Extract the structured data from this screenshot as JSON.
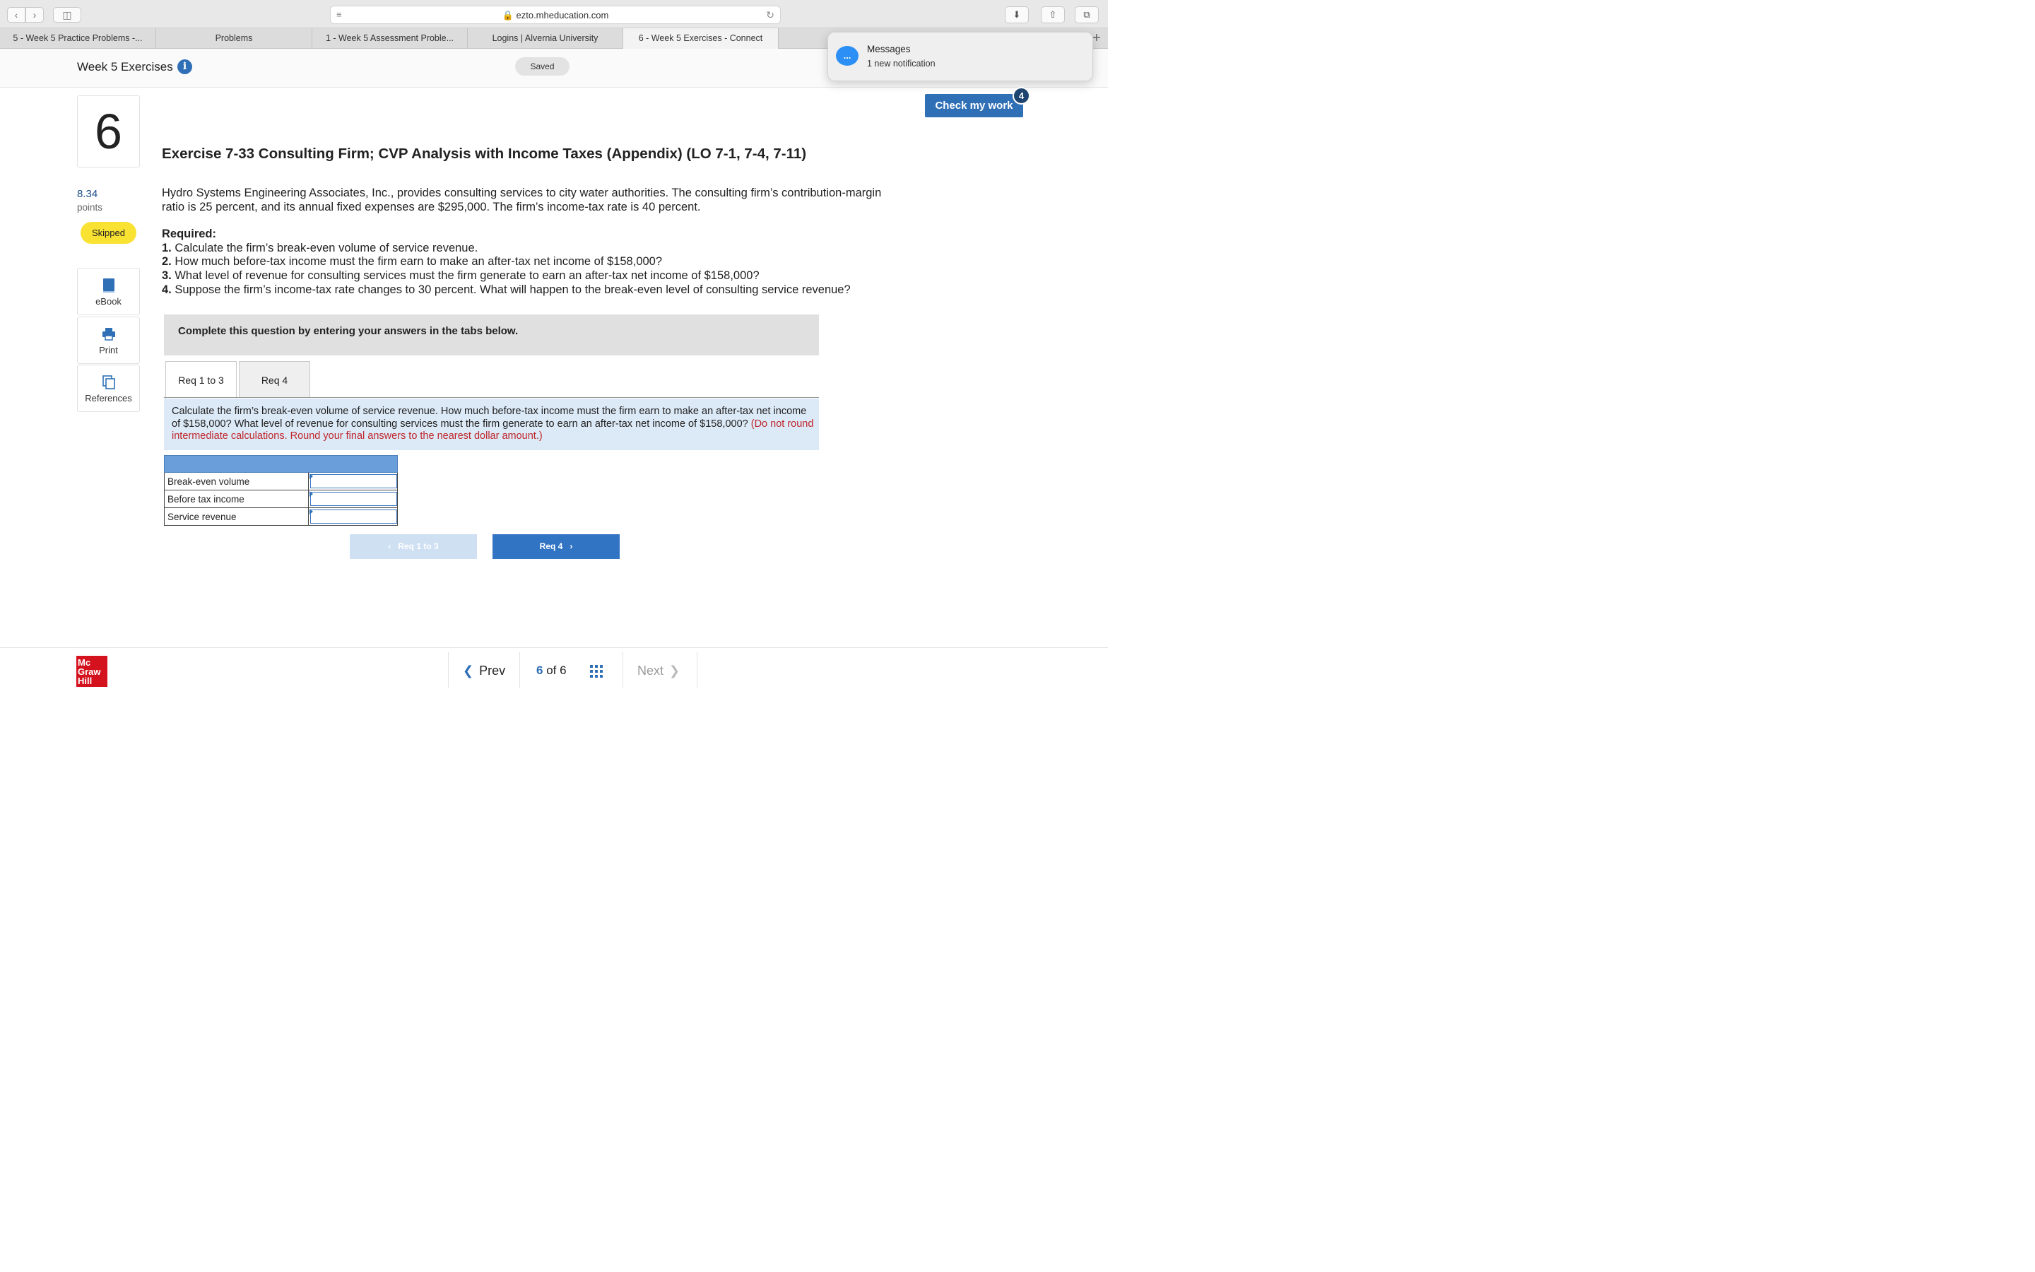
{
  "browser": {
    "url": "ezto.mheducation.com",
    "tabs": [
      {
        "label": "5 - Week 5 Practice Problems -...",
        "active": false
      },
      {
        "label": "Problems",
        "active": false
      },
      {
        "label": "1 - Week 5 Assessment Proble...",
        "active": false
      },
      {
        "label": "Logins | Alvernia University",
        "active": false
      },
      {
        "label": "6 - Week 5 Exercises - Connect",
        "active": true
      }
    ],
    "new_tab": "+"
  },
  "header": {
    "assignment_title": "Week 5 Exercises",
    "info_icon": "i",
    "saved": "Saved"
  },
  "notification": {
    "title": "Messages",
    "body": "1 new notification",
    "icon": "..."
  },
  "check_work": {
    "label": "Check my work",
    "badge": "4"
  },
  "left_rail": {
    "question_number": "6",
    "points_value": "8.34",
    "points_label": "points",
    "status": "Skipped",
    "tools": [
      {
        "label": "eBook",
        "icon": "book-icon"
      },
      {
        "label": "Print",
        "icon": "printer-icon"
      },
      {
        "label": "References",
        "icon": "references-icon"
      }
    ]
  },
  "question": {
    "title": "Exercise 7-33 Consulting Firm; CVP Analysis with Income Taxes (Appendix) (LO 7-1, 7-4, 7-11)",
    "intro": "Hydro Systems Engineering Associates, Inc., provides consulting services to city water authorities. The consulting firm’s contribution-margin ratio is 25 percent, and its annual fixed expenses are $295,000. The firm’s income-tax rate is 40 percent.",
    "required_label": "Required:",
    "required": [
      {
        "num": "1.",
        "text": " Calculate the firm’s break-even volume of service revenue."
      },
      {
        "num": "2.",
        "text": " How much before-tax income must the firm earn to make an after-tax net income of $158,000?"
      },
      {
        "num": "3.",
        "text": " What level of revenue for consulting services must the firm generate to earn an after-tax net income of $158,000?"
      },
      {
        "num": "4.",
        "text": " Suppose the firm’s income-tax rate changes to 30 percent. What will happen to the break-even level of consulting service revenue?"
      }
    ],
    "instructions": "Complete this question by entering your answers in the tabs below.",
    "tabs": [
      "Req 1 to 3",
      "Req 4"
    ],
    "prompt": "Calculate the firm’s break-even volume of service revenue. How much before-tax income must the firm earn to make an after-tax net income of $158,000? What level of revenue for consulting services must the firm generate to earn an after-tax net income of $158,000?",
    "prompt_note": "(Do not round intermediate calculations. Round your final answers to the nearest dollar amount.)",
    "answer_rows": [
      {
        "label": "Break-even volume",
        "value": ""
      },
      {
        "label": "Before tax income",
        "value": ""
      },
      {
        "label": "Service revenue",
        "value": ""
      }
    ],
    "prev_req": "Req 1 to 3",
    "next_req": "Req 4"
  },
  "footer": {
    "logo": [
      "Mc",
      "Graw",
      "Hill"
    ],
    "prev": "Prev",
    "current": "6",
    "of": "of",
    "total": "6",
    "next": "Next"
  }
}
